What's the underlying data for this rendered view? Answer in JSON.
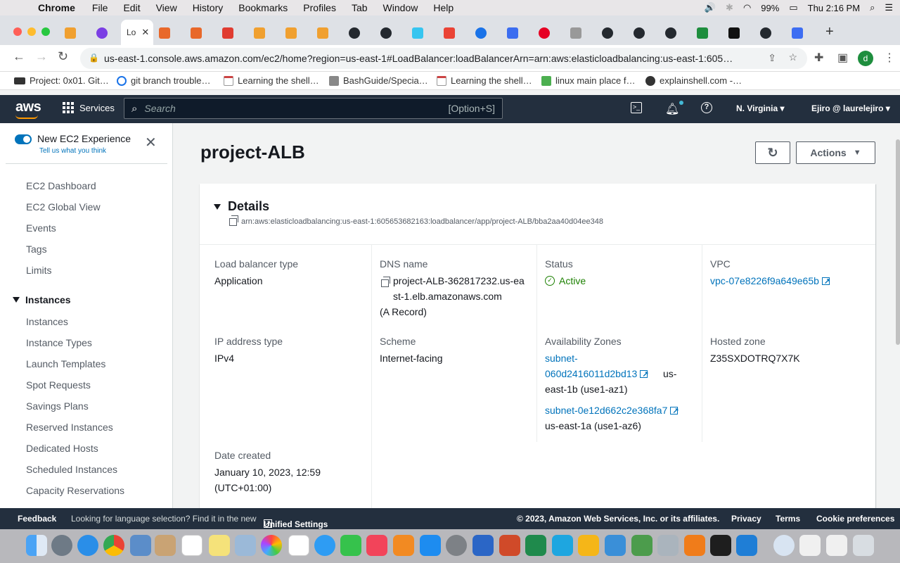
{
  "mac_menu": {
    "items": [
      "Chrome",
      "File",
      "Edit",
      "View",
      "History",
      "Bookmarks",
      "Profiles",
      "Tab",
      "Window",
      "Help"
    ],
    "battery": "99%",
    "clock": "Thu 2:16 PM"
  },
  "chrome": {
    "active_tab_label": "Lo",
    "url": "us-east-1.console.aws.amazon.com/ec2/home?region=us-east-1#LoadBalancer:loadBalancerArn=arn:aws:elasticloadbalancing:us-east-1:605…",
    "profile_initial": "d",
    "bookmarks": [
      "Project: 0x01. Git…",
      "git branch trouble…",
      "Learning the shell…",
      "BashGuide/Specia…",
      "Learning the shell…",
      "linux main place f…",
      "explainshell.com -…"
    ]
  },
  "aws_nav": {
    "services": "Services",
    "search_placeholder": "Search",
    "search_hint": "[Option+S]",
    "region": "N. Virginia",
    "user": "Ejiro @ laurelejiro"
  },
  "sidebar": {
    "experience_title": "New EC2 Experience",
    "experience_sub": "Tell us what you think",
    "top_items": [
      "EC2 Dashboard",
      "EC2 Global View",
      "Events",
      "Tags",
      "Limits"
    ],
    "section": "Instances",
    "section_items": [
      "Instances",
      "Instance Types",
      "Launch Templates",
      "Spot Requests",
      "Savings Plans",
      "Reserved Instances",
      "Dedicated Hosts",
      "Scheduled Instances",
      "Capacity Reservations"
    ]
  },
  "main": {
    "title": "project-ALB",
    "actions_label": "Actions",
    "details": {
      "heading": "Details",
      "arn": "arn:aws:elasticloadbalancing:us-east-1:605653682163:loadbalancer/app/project-ALB/bba2aa40d04ee348",
      "load_balancer_type_label": "Load balancer type",
      "load_balancer_type": "Application",
      "dns_label": "DNS name",
      "dns_line1": "project-ALB-362817232.us-ea",
      "dns_line2": "st-1.elb.amazonaws.com",
      "dns_record": "(A Record)",
      "status_label": "Status",
      "status": "Active",
      "vpc_label": "VPC",
      "vpc": "vpc-07e8226f9a649e65b",
      "ip_type_label": "IP address type",
      "ip_type": "IPv4",
      "scheme_label": "Scheme",
      "scheme": "Internet-facing",
      "az_label": "Availability Zones",
      "az1_subnet_line1": "subnet-",
      "az1_subnet_line2": "060d2416011d2bd13",
      "az1_zone_a": "us-",
      "az1_zone_b": "east-1b (use1-az1)",
      "az2_subnet": "subnet-0e12d662c2e368fa7",
      "az2_zone": "us-east-1a (use1-az6)",
      "hosted_zone_label": "Hosted zone",
      "hosted_zone": "Z35SXDOTRQ7X7K",
      "date_label": "Date created",
      "date_line1": "January 10, 2023, 12:59",
      "date_line2": "(UTC+01:00)"
    }
  },
  "footer": {
    "feedback": "Feedback",
    "lang_note": "Looking for language selection? Find it in the new",
    "unified": "Unified Settings",
    "copyright": "© 2023, Amazon Web Services, Inc. or its affiliates.",
    "privacy": "Privacy",
    "terms": "Terms",
    "cookies": "Cookie preferences"
  },
  "colors": {
    "aws_nav": "#232f3e",
    "aws_orange": "#ff9900",
    "link": "#0073bb",
    "success": "#1d8102"
  }
}
